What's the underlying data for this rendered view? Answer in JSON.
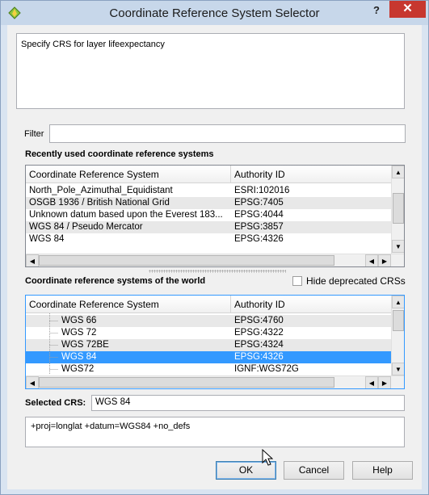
{
  "window": {
    "title": "Coordinate Reference System Selector",
    "help_label": "?",
    "close_label": "✕"
  },
  "description": "Specify CRS for layer lifeexpectancy",
  "filter": {
    "label": "Filter",
    "value": ""
  },
  "recent": {
    "title": "Recently used coordinate reference systems",
    "columns": [
      "Coordinate Reference System",
      "Authority ID"
    ],
    "rows": [
      {
        "name": "North_Pole_Azimuthal_Equidistant",
        "id": "ESRI:102016"
      },
      {
        "name": "OSGB 1936 / British National Grid",
        "id": "EPSG:7405"
      },
      {
        "name": "Unknown datum based upon the Everest 183...",
        "id": "EPSG:4044"
      },
      {
        "name": "WGS 84 / Pseudo Mercator",
        "id": "EPSG:3857"
      },
      {
        "name": "WGS 84",
        "id": "EPSG:4326"
      }
    ]
  },
  "world": {
    "title": "Coordinate reference systems of the world",
    "hide_deprecated_label": "Hide deprecated CRSs",
    "hide_deprecated_checked": false,
    "columns": [
      "Coordinate Reference System",
      "Authority ID"
    ],
    "rows": [
      {
        "name": "WGS 66",
        "id": "EPSG:4760",
        "selected": false
      },
      {
        "name": "WGS 72",
        "id": "EPSG:4322",
        "selected": false
      },
      {
        "name": "WGS 72BE",
        "id": "EPSG:4324",
        "selected": false
      },
      {
        "name": "WGS 84",
        "id": "EPSG:4326",
        "selected": true
      },
      {
        "name": "WGS72",
        "id": "IGNF:WGS72G",
        "selected": false
      }
    ]
  },
  "selected_crs": {
    "label": "Selected CRS:",
    "value": "WGS 84"
  },
  "proj_string": "+proj=longlat +datum=WGS84 +no_defs",
  "buttons": {
    "ok": "OK",
    "cancel": "Cancel",
    "help": "Help"
  },
  "colors": {
    "selection": "#3399ff",
    "close_button": "#c7372f",
    "title_bar": "#c7d7ea"
  }
}
